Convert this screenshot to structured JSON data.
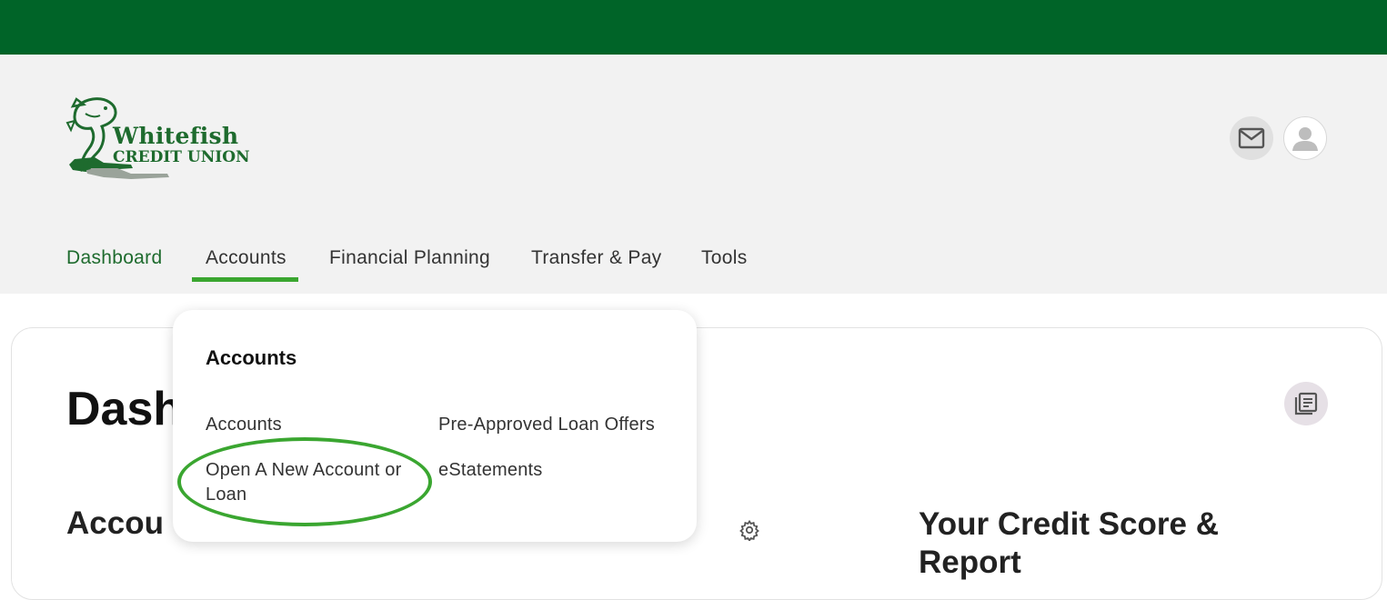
{
  "brand": {
    "name": "Whitefish",
    "subtitle": "CREDIT UNION",
    "colors": {
      "green": "#006428",
      "accent": "#3aa630",
      "logo": "#1e6b2e"
    }
  },
  "header": {
    "mail_icon": "envelope-icon",
    "profile_icon": "person-silhouette-icon"
  },
  "nav": {
    "dashboard": "Dashboard",
    "accounts": "Accounts",
    "financial_planning": "Financial Planning",
    "transfer_pay": "Transfer & Pay",
    "tools": "Tools",
    "active": "Accounts"
  },
  "dropdown": {
    "title": "Accounts",
    "links": {
      "accounts": "Accounts",
      "open_account": "Open A New Account or Loan",
      "preapproved": "Pre-Approved Loan Offers",
      "estatements": "eStatements"
    },
    "highlighted": "Open A New Account or Loan"
  },
  "main": {
    "page_heading": "Dash",
    "section_heading": "Accou",
    "credit_heading": "Your Credit Score & Report",
    "settings_icon": "gear-icon",
    "document_icon": "document-list-icon"
  }
}
